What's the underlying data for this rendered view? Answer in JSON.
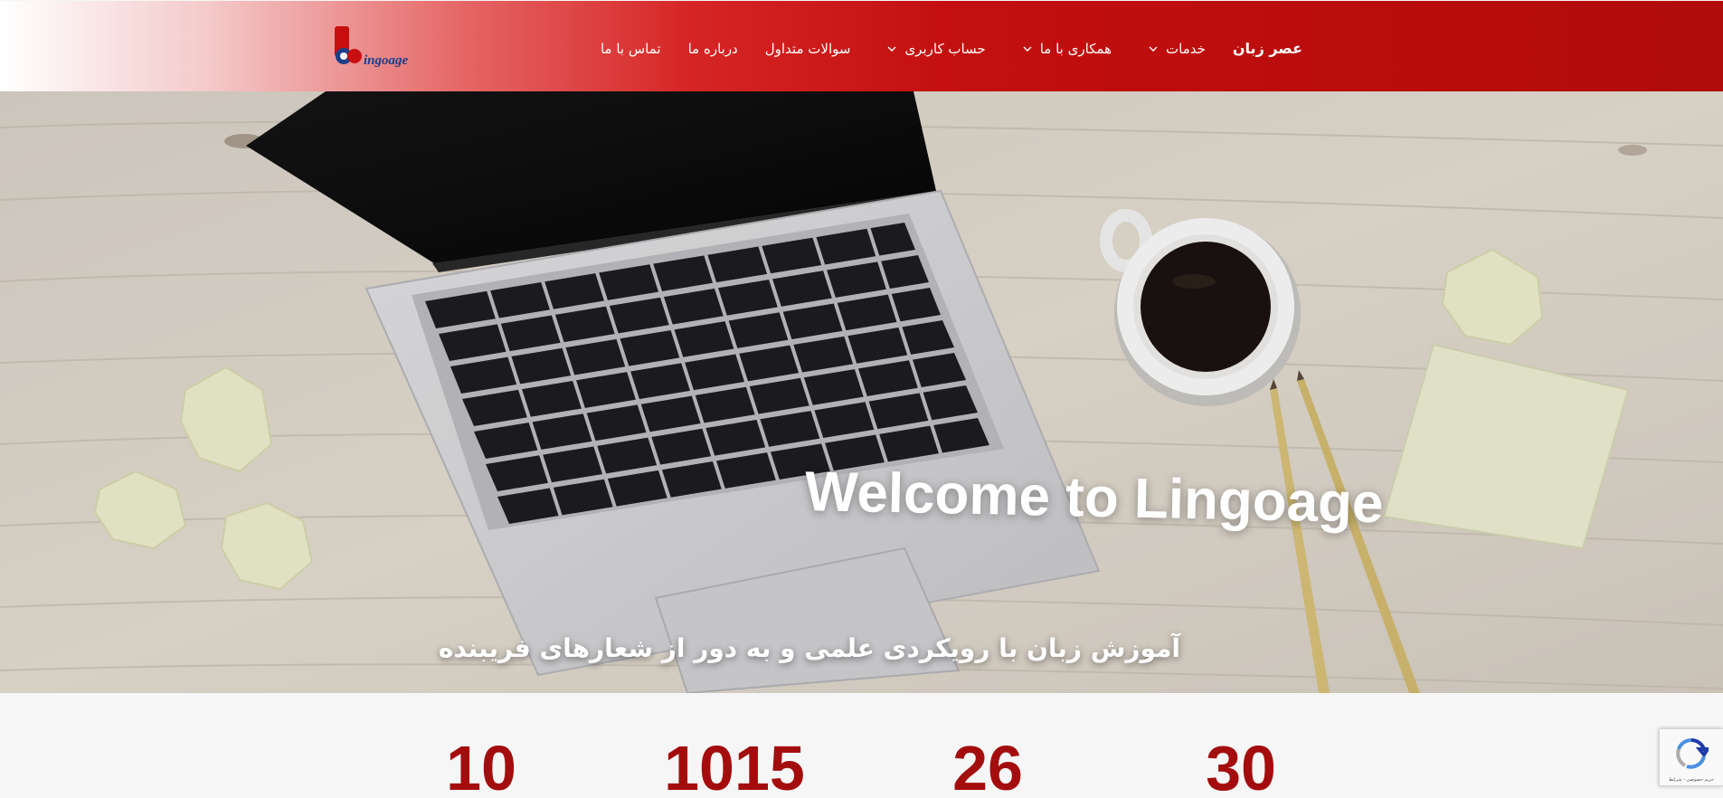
{
  "header": {
    "logo_text": "ingoage",
    "nav": [
      {
        "label": "عصر زبان",
        "has_dropdown": false,
        "bold": true
      },
      {
        "label": "خدمات",
        "has_dropdown": true
      },
      {
        "label": "همکاری با ما",
        "has_dropdown": true
      },
      {
        "label": "حساب کاربری",
        "has_dropdown": true
      },
      {
        "label": "سوالات متداول",
        "has_dropdown": false
      },
      {
        "label": "درباره ما",
        "has_dropdown": false
      },
      {
        "label": "تماس با ما",
        "has_dropdown": false
      }
    ],
    "colors": {
      "gradient_start": "#ffffff",
      "gradient_end": "#b10b0b"
    }
  },
  "hero": {
    "title": "Welcome to Lingoage",
    "subtitle": "آموزش زبان با رویکردی علمی و به دور از شعارهای فریبنده"
  },
  "stats": [
    "10",
    "1015",
    "26",
    "30"
  ],
  "recaptcha": {
    "links": "حریم خصوصی - شرایط",
    "icon": "recaptcha-icon"
  },
  "colors": {
    "accent": "#a40d0d",
    "header_red": "#c30f0f"
  }
}
